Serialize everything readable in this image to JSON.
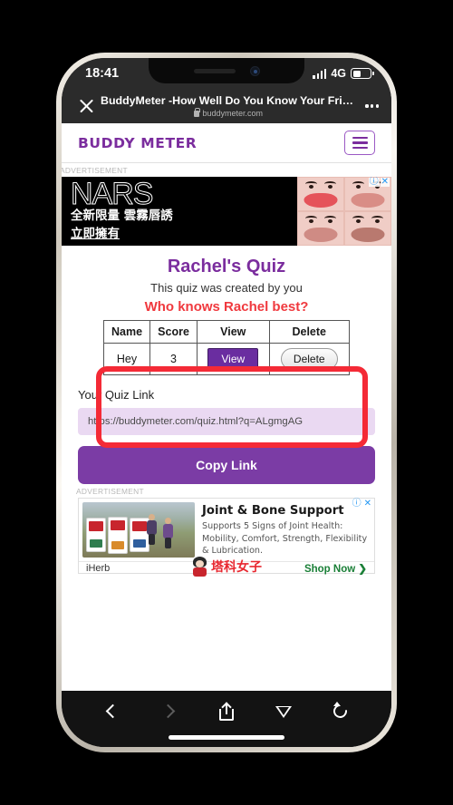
{
  "status_bar": {
    "time": "18:41",
    "network": "4G"
  },
  "browser": {
    "page_title": "BuddyMeter -How Well Do You Know Your Frie…",
    "url": "buddymeter.com",
    "close_label": "",
    "more_label": ""
  },
  "site": {
    "brand": "BUDDY METER",
    "ad_label_top": "ADVERTISEMENT",
    "ad_label_bottom": "ADVERTISEMENT"
  },
  "top_ad": {
    "wordmark": "NARS",
    "line1": "全新限量 雲霧唇誘",
    "line2": "立即擁有",
    "info_glyph": "ⓘ",
    "close_glyph": "✕"
  },
  "quiz": {
    "title": "Rachel's Quiz",
    "subtitle": "This quiz was created by you",
    "question": "Who knows Rachel best?",
    "table": {
      "headers": [
        "Name",
        "Score",
        "View",
        "Delete"
      ],
      "rows": [
        {
          "name": "Hey",
          "score": "3",
          "view_label": "View",
          "delete_label": "Delete"
        }
      ]
    },
    "link_label": "Your Quiz Link",
    "link_value": "https://buddymeter.com/quiz.html?q=ALgmgAG",
    "copy_button": "Copy Link"
  },
  "bottom_ad": {
    "headline": "Joint & Bone Support",
    "description": "Supports 5 Signs of Joint Health: Mobility, Comfort, Strength, Flexibility & Lubrication.",
    "brand": "iHerb",
    "cta": "Shop Now ❯",
    "watermark": "塔科女子",
    "info_glyph": "ⓘ",
    "close_glyph": "✕"
  },
  "toolbar": {
    "back": "Back",
    "forward": "Forward",
    "share": "Share",
    "send": "Send",
    "reload": "Reload"
  },
  "colors": {
    "brand_purple": "#7b2d9e",
    "button_purple": "#7b3ca5",
    "view_purple": "#6a2da0",
    "question_red": "#f0393e",
    "annotation_red": "#f42a36",
    "link_bg": "#ead9f2",
    "cta_green": "#1a7f37"
  }
}
